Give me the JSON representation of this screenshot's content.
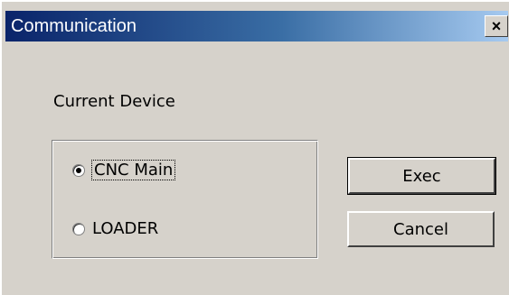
{
  "window": {
    "title": "Communication",
    "close_label": "×"
  },
  "current_device": {
    "label": "Current Device",
    "options": [
      {
        "label": "CNC Main",
        "selected": true
      },
      {
        "label": "LOADER",
        "selected": false
      }
    ]
  },
  "buttons": {
    "exec_label": "Exec",
    "cancel_label": "Cancel"
  },
  "colors": {
    "title_gradient_start": "#0a246a",
    "title_gradient_end": "#a6caf0",
    "dialog_bg": "#d6d2cb"
  }
}
